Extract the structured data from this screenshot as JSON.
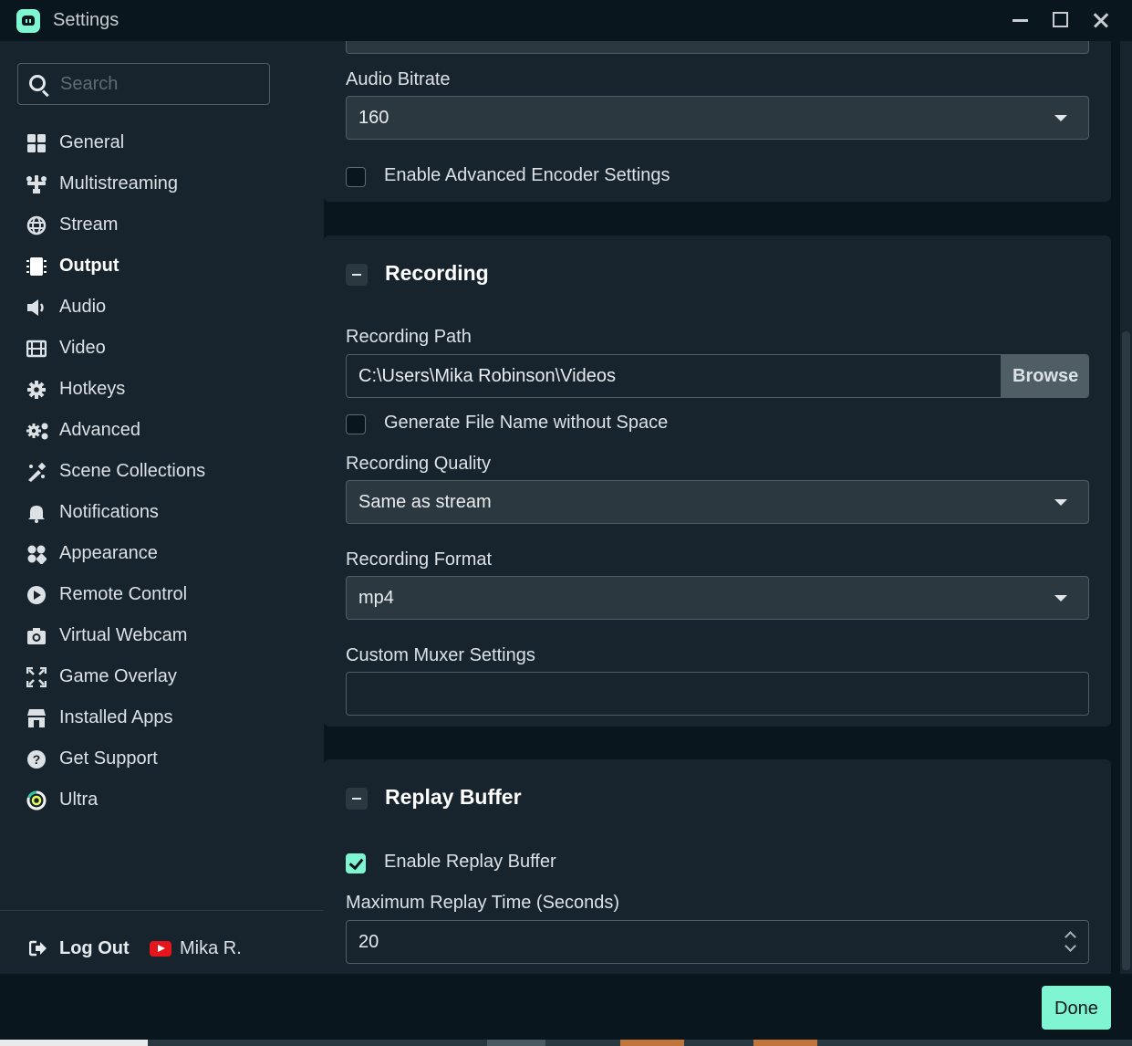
{
  "window": {
    "title": "Settings"
  },
  "sidebar": {
    "search_placeholder": "Search",
    "items": [
      {
        "label": "General",
        "icon": "grid-icon"
      },
      {
        "label": "Multistreaming",
        "icon": "multistream-icon"
      },
      {
        "label": "Stream",
        "icon": "globe-icon"
      },
      {
        "label": "Output",
        "icon": "output-icon"
      },
      {
        "label": "Audio",
        "icon": "speaker-icon"
      },
      {
        "label": "Video",
        "icon": "film-icon"
      },
      {
        "label": "Hotkeys",
        "icon": "gear-icon"
      },
      {
        "label": "Advanced",
        "icon": "gears-icon"
      },
      {
        "label": "Scene Collections",
        "icon": "scenes-icon"
      },
      {
        "label": "Notifications",
        "icon": "bell-icon"
      },
      {
        "label": "Appearance",
        "icon": "appearance-icon"
      },
      {
        "label": "Remote Control",
        "icon": "play-circle-icon"
      },
      {
        "label": "Virtual Webcam",
        "icon": "camera-icon"
      },
      {
        "label": "Game Overlay",
        "icon": "expand-icon"
      },
      {
        "label": "Installed Apps",
        "icon": "store-icon"
      },
      {
        "label": "Get Support",
        "icon": "help-icon"
      },
      {
        "label": "Ultra",
        "icon": "ultra-icon"
      }
    ],
    "active": "Output",
    "footer": {
      "logout_label": "Log Out",
      "user_name": "Mika R."
    }
  },
  "streaming": {
    "audio_bitrate_label": "Audio Bitrate",
    "audio_bitrate_value": "160",
    "advanced_encoder_label": "Enable Advanced Encoder Settings",
    "advanced_encoder_checked": false
  },
  "recording": {
    "title": "Recording",
    "path_label": "Recording Path",
    "path_value": "C:\\Users\\Mika Robinson\\Videos",
    "browse_label": "Browse",
    "no_space_label": "Generate File Name without Space",
    "no_space_checked": false,
    "quality_label": "Recording Quality",
    "quality_value": "Same as stream",
    "format_label": "Recording Format",
    "format_value": "mp4",
    "muxer_label": "Custom Muxer Settings",
    "muxer_value": ""
  },
  "replay_buffer": {
    "title": "Replay Buffer",
    "enable_label": "Enable Replay Buffer",
    "enable_checked": true,
    "max_time_label": "Maximum Replay Time (Seconds)",
    "max_time_value": "20"
  },
  "footer": {
    "done_label": "Done"
  },
  "colors": {
    "accent": "#80f5d2",
    "background": "#09161d",
    "panel": "#17242d",
    "control": "#2b383f",
    "border": "#4f5e65",
    "youtube": "#e4151b"
  }
}
